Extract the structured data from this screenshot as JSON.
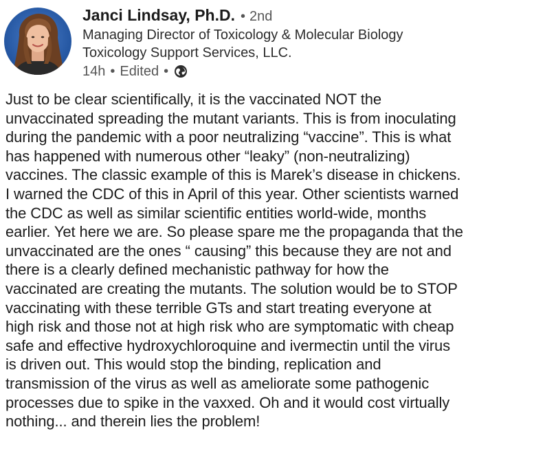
{
  "post": {
    "author": {
      "name": "Janci Lindsay, Ph.D.",
      "separator": "•",
      "degree": "2nd",
      "headline_lines": [
        "Managing Director of Toxicology & Molecular Biology",
        "Toxicology Support Services, LLC."
      ],
      "avatar_icon": "profile-photo"
    },
    "meta": {
      "time": "14h",
      "separator": "•",
      "edited": "Edited",
      "visibility_icon": "globe-icon"
    },
    "body_lines": [
      "Just to be clear scientifically,  it is the vaccinated NOT the",
      "unvaccinated spreading the mutant variants. This is from inoculating",
      "during the pandemic with a poor neutralizing “vaccine”. This is what",
      "has happened with numerous other “leaky” (non-neutralizing)",
      "vaccines. The classic example of this is Marek’s disease in chickens.",
      "I warned the CDC of this in April of this year. Other scientists warned",
      "the CDC as well as similar scientific entities world-wide, months",
      "earlier. Yet here we are. So please spare me the propaganda that the",
      "unvaccinated are the ones “ causing” this because they are not and",
      "there is a clearly defined mechanistic pathway for how the",
      "vaccinated are creating the mutants. The solution would be to STOP",
      "vaccinating with these terrible GTs and start treating everyone at",
      "high risk and those not at high risk who are symptomatic with cheap",
      "safe and effective hydroxychloroquine and ivermectin until the virus",
      "is driven out. This would stop the binding, replication and",
      "transmission of the virus as well as ameliorate some pathogenic",
      "processes due to spike in the vaxxed. Oh and it would cost virtually",
      "nothing... and therein lies the problem!"
    ]
  },
  "colors": {
    "text_primary": "#1b1b1b",
    "text_secondary": "#555555",
    "background": "#ffffff"
  }
}
